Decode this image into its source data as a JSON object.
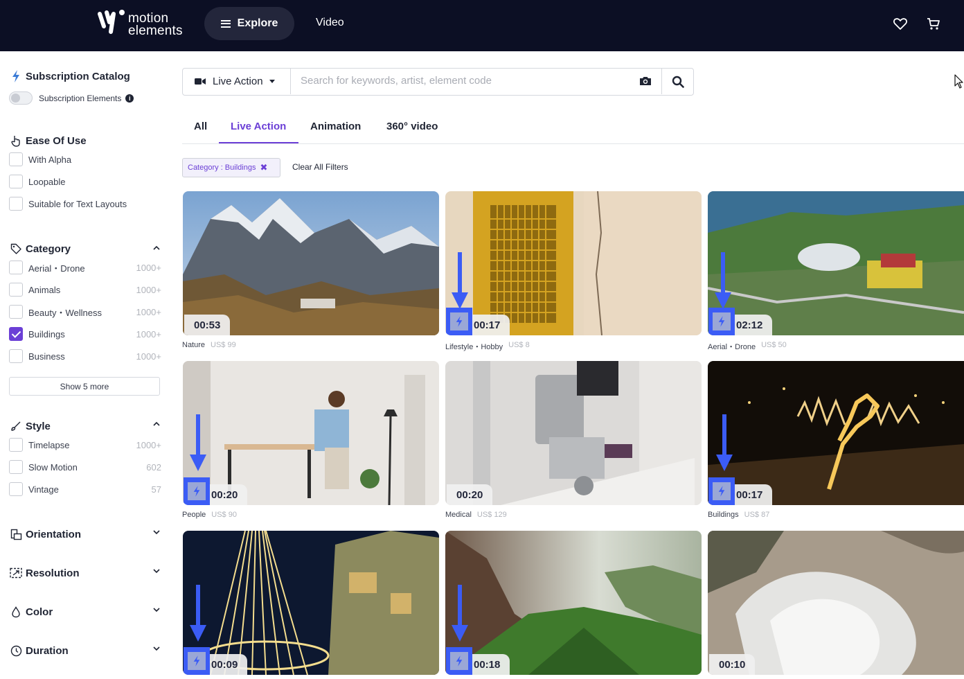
{
  "brand": {
    "logo_line1": "motion",
    "logo_line2": "elements"
  },
  "topnav": {
    "explore_label": "Explore",
    "video_label": "Video"
  },
  "sidebar": {
    "subscription": {
      "title": "Subscription Catalog",
      "toggle_label": "Subscription Elements",
      "info": "i"
    },
    "ease": {
      "title": "Ease Of Use",
      "items": [
        {
          "label": "With Alpha"
        },
        {
          "label": "Loopable"
        },
        {
          "label": "Suitable for Text Layouts"
        }
      ]
    },
    "category": {
      "title": "Category",
      "items": [
        {
          "label": "Aerial・Drone",
          "count": "1000+",
          "checked": false
        },
        {
          "label": "Animals",
          "count": "1000+",
          "checked": false
        },
        {
          "label": "Beauty・Wellness",
          "count": "1000+",
          "checked": false
        },
        {
          "label": "Buildings",
          "count": "1000+",
          "checked": true
        },
        {
          "label": "Business",
          "count": "1000+",
          "checked": false
        }
      ],
      "show_more": "Show 5 more"
    },
    "style": {
      "title": "Style",
      "items": [
        {
          "label": "Timelapse",
          "count": "1000+"
        },
        {
          "label": "Slow Motion",
          "count": "602"
        },
        {
          "label": "Vintage",
          "count": "57"
        }
      ]
    },
    "orientation": {
      "title": "Orientation"
    },
    "resolution": {
      "title": "Resolution"
    },
    "color": {
      "title": "Color"
    },
    "duration": {
      "title": "Duration"
    }
  },
  "search": {
    "media_type": "Live Action",
    "placeholder": "Search for keywords, artist, element code"
  },
  "tabs": [
    {
      "label": "All",
      "active": false
    },
    {
      "label": "Live Action",
      "active": true
    },
    {
      "label": "Animation",
      "active": false
    },
    {
      "label": "360° video",
      "active": false
    }
  ],
  "filters": {
    "chip_label": "Category : Buildings",
    "chip_remove": "✖",
    "clear_all": "Clear All Filters"
  },
  "results": [
    {
      "duration": "00:53",
      "category": "Nature",
      "price": "US$ 99",
      "subscription": false
    },
    {
      "duration": "00:17",
      "category": "Lifestyle・Hobby",
      "price": "US$ 8",
      "subscription": true
    },
    {
      "duration": "02:12",
      "category": "Aerial・Drone",
      "price": "US$ 50",
      "subscription": true
    },
    {
      "duration": "00:20",
      "category": "People",
      "price": "US$ 90",
      "subscription": true
    },
    {
      "duration": "00:20",
      "category": "Medical",
      "price": "US$ 129",
      "subscription": false
    },
    {
      "duration": "00:17",
      "category": "Buildings",
      "price": "US$ 87",
      "subscription": true
    },
    {
      "duration": "00:09",
      "category": "",
      "price": "",
      "subscription": true
    },
    {
      "duration": "00:18",
      "category": "",
      "price": "",
      "subscription": true
    },
    {
      "duration": "00:10",
      "category": "",
      "price": "",
      "subscription": false
    }
  ],
  "colors": {
    "accent": "#6b3fd6",
    "topbar": "#0c0f24",
    "highlight": "#3b5cf5"
  }
}
